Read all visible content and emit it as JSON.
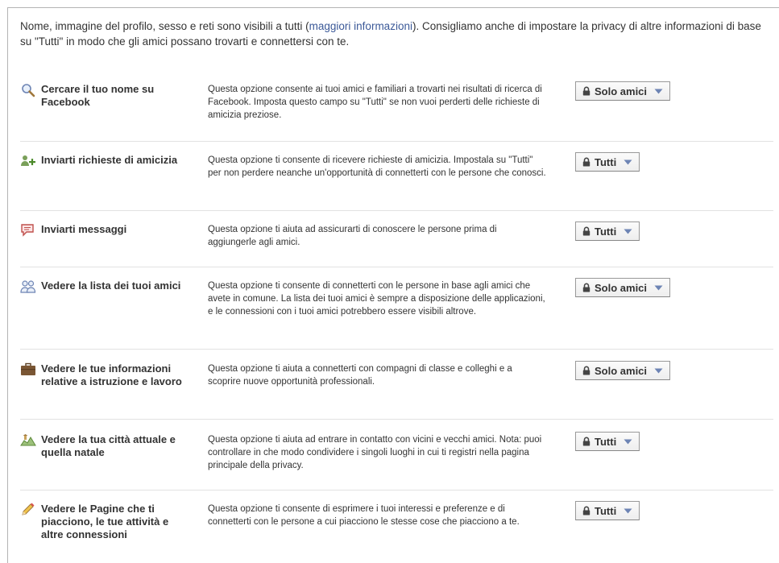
{
  "intro": {
    "text_before": "Nome, immagine del profilo, sesso e reti sono visibili a tutti (",
    "link": "maggiori informazioni",
    "text_after": "). Consigliamo anche di impostare la privacy di altre informazioni di base su \"Tutti\" in modo che gli amici possano trovarti e connettersi con te."
  },
  "rows": [
    {
      "title": "Cercare il tuo nome su Facebook",
      "icon": "magnifier-icon",
      "description": "Questa opzione consente ai tuoi amici e familiari a trovarti nei risultati di ricerca di Facebook. Imposta questo campo su \"Tutti\" se non vuoi perderti delle richieste di amicizia preziose.",
      "setting": "Solo amici"
    },
    {
      "title": "Inviarti richieste di amicizia",
      "icon": "add-friend-icon",
      "description": "Questa opzione ti consente di ricevere richieste di amicizia. Impostala su \"Tutti\" per non perdere neanche un'opportunità di connetterti con le persone che conosci.",
      "setting": "Tutti"
    },
    {
      "title": "Inviarti messaggi",
      "icon": "message-icon",
      "description": "Questa opzione ti aiuta ad assicurarti di conoscere le persone prima di aggiungerle agli amici.",
      "setting": "Tutti"
    },
    {
      "title": "Vedere la lista dei tuoi amici",
      "icon": "friends-icon",
      "description": "Questa opzione ti consente di connetterti con le persone in base agli amici che avete in comune. La lista dei tuoi amici è sempre a disposizione delle applicazioni, e le connessioni con i tuoi amici potrebbero essere visibili altrove.",
      "setting": "Solo amici"
    },
    {
      "title": "Vedere le tue informazioni relative a istruzione e lavoro",
      "icon": "briefcase-icon",
      "description": "Questa opzione ti aiuta a connetterti con compagni di classe e colleghi e a scoprire nuove opportunità professionali.",
      "setting": "Solo amici"
    },
    {
      "title": "Vedere la tua città attuale e quella natale",
      "icon": "map-icon",
      "description": "Questa opzione ti aiuta ad entrare in contatto con vicini e vecchi amici. Nota: puoi controllare in che modo condividere i singoli luoghi in cui ti registri nella pagina principale della privacy.",
      "setting": "Tutti"
    },
    {
      "title": "Vedere le Pagine che ti piacciono, le tue attività e altre connessioni",
      "icon": "pencil-icon",
      "description": "Questa opzione ti consente di esprimere i tuoi interessi e preferenze e di connetterti con le persone a cui piacciono le stesse cose che piacciono a te.",
      "setting": "Tutti"
    }
  ]
}
